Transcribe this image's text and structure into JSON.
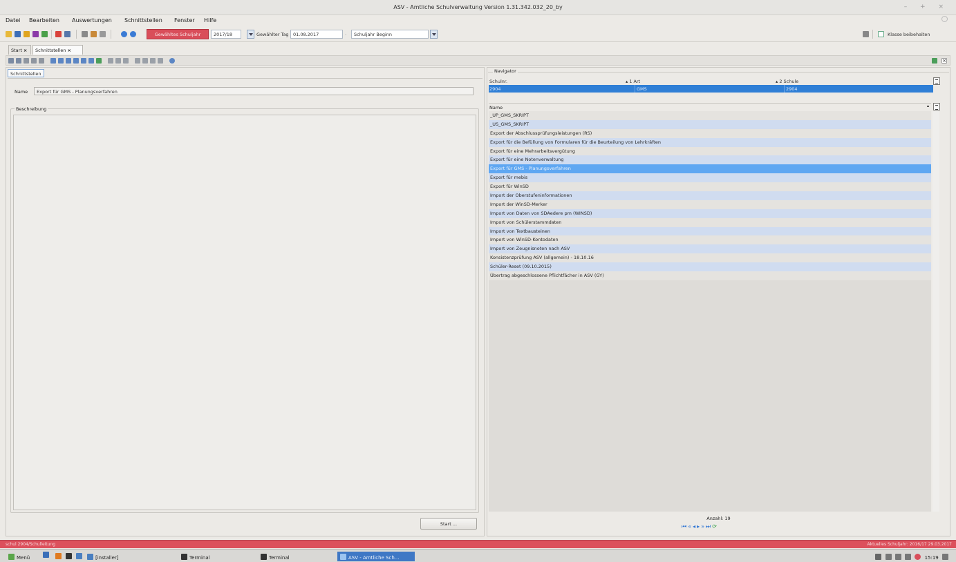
{
  "window": {
    "title": "ASV - Amtliche Schulverwaltung Version 1.31.342.032_20_by",
    "controls": "– + ×"
  },
  "menu": {
    "items": [
      "Datei",
      "Bearbeiten",
      "Auswertungen",
      "Schnittstellen",
      "Fenster",
      "Hilfe"
    ]
  },
  "toolbar": {
    "schuljahr_button": "Gewähltes Schuljahr",
    "schuljahr_value": "2017/18",
    "tag_label": "Gewählter Tag",
    "tag_value": "01.08.2017",
    "zeitpunkt_value": "Schuljahr Beginn",
    "keep_class_label": "Klasse beibehalten",
    "keep_class_checked": true
  },
  "tabs": [
    {
      "label": "Start",
      "active": false
    },
    {
      "label": "Schnittstellen",
      "active": true
    }
  ],
  "left": {
    "tab": "Schnittstellen",
    "name_label": "Name",
    "name_value": "Export für GMS - Planungsverfahren",
    "description_label": "Beschreibung",
    "start_button": "Start ..."
  },
  "navigator": {
    "title": "Navigator",
    "columns": [
      "Schulnr.",
      "▴ 1 Art",
      "▴ 2 Schule"
    ],
    "selected_row": [
      "2904",
      "GMS",
      "2904"
    ],
    "list_header": "Name",
    "items": [
      "_UP_GMS_SKRIPT",
      "_US_GMS_SKRIPT",
      "Export der Abschlussprüfungsleistungen (RS)",
      "Export für die Befüllung von Formularen für die Beurteilung von Lehrkräften",
      "Export für eine Mehrarbeitsvergütung",
      "Export für eine Notenverwaltung",
      "Export für GMS - Planungsverfahren",
      "Export für mebis",
      "Export für WinSD",
      "Import der Oberstufeninformationen",
      "Import der WinSD-Merker",
      "Import von Daten von SDAedere pm (WINSD)",
      "Import von Schülerstammdaten",
      "Import von Textbausteinen",
      "Import von WinSD-Kontodaten",
      "Import von Zeugnisnoten nach ASV",
      "Konsistenzprüfung ASV (allgemein) - 18.10.16",
      "Schüler-Reset (09.10.2015)",
      "Übertrag abgeschlossene Pflichtfächer in ASV (GY)"
    ],
    "selected_index": 6,
    "count_label": "Anzahl: 19"
  },
  "status": {
    "left": "schul 2904/Schulleitung",
    "right": "Aktuelles Schuljahr: 2016/17 29.03.2017"
  },
  "taskbar": {
    "menu": "Menü",
    "installer": "[installer]",
    "terminal1": "Terminal",
    "terminal2": "Terminal",
    "asv": "ASV - Amtliche Sch...",
    "clock": "15:19"
  },
  "colors": {
    "accent_red": "#d94e5a",
    "selection_blue": "#2f7fd6",
    "row_selected": "#5fa7f2",
    "row_stripe": "#d0dcf0"
  }
}
